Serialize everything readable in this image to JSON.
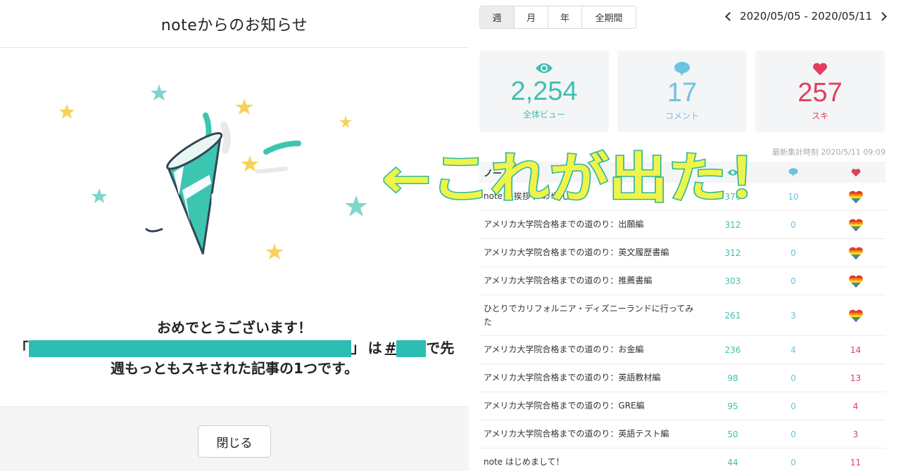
{
  "modal": {
    "title": "noteからのお知らせ",
    "message_line1": "おめでとうございます！",
    "open_quote": "「",
    "close_quote": "」",
    "mid_text": "は",
    "hash": "#",
    "after_rank": "で先",
    "message_line3": "週もっともスキされた記事の1つです。",
    "close_button": "閉じる",
    "colors": {
      "redaction": "#2bbcb3",
      "star_yellow": "#f7d25a",
      "star_teal": "#7fd6cc",
      "party": "#3cc5b0"
    }
  },
  "stats": {
    "tabs": [
      "週",
      "月",
      "年",
      "全期間"
    ],
    "active_tab": "週",
    "date_range": "2020/05/05 - 2020/05/11",
    "cards": {
      "views": {
        "value": "2,254",
        "label": "全体ビュー"
      },
      "comments": {
        "value": "17",
        "label": "コメント"
      },
      "likes": {
        "value": "257",
        "label": "スキ"
      }
    },
    "updated": "最新集計時刻 2020/5/11 09:09",
    "table_header": "ノート",
    "rows": [
      {
        "title": "noteで 挨拶す のや した！",
        "views": "376",
        "comments": "10",
        "likes": ""
      },
      {
        "title": "アメリカ大学院合格までの道のり：出願編",
        "views": "312",
        "comments": "0",
        "likes": ""
      },
      {
        "title": "アメリカ大学院合格までの道のり：英文履歴書編",
        "views": "312",
        "comments": "0",
        "likes": ""
      },
      {
        "title": "アメリカ大学院合格までの道のり：推薦書編",
        "views": "303",
        "comments": "0",
        "likes": ""
      },
      {
        "title": "ひとりでカリフォルニア・ディズニーランドに行ってみた",
        "views": "261",
        "comments": "3",
        "likes": ""
      },
      {
        "title": "アメリカ大学院合格までの道のり：お金編",
        "views": "236",
        "comments": "4",
        "likes": "14"
      },
      {
        "title": "アメリカ大学院合格までの道のり：英語教材編",
        "views": "98",
        "comments": "0",
        "likes": "13"
      },
      {
        "title": "アメリカ大学院合格までの道のり：GRE編",
        "views": "95",
        "comments": "0",
        "likes": "4"
      },
      {
        "title": "アメリカ大学院合格までの道のり：英語テスト編",
        "views": "50",
        "comments": "0",
        "likes": "3"
      },
      {
        "title": "note はじめまして！",
        "views": "44",
        "comments": "0",
        "likes": "11"
      }
    ],
    "colors": {
      "views": "#3fc0b0",
      "comments": "#6cc3e2",
      "likes": "#e0405e"
    }
  },
  "annotation": {
    "text": "←これが出た！",
    "colors": {
      "fill": "#eef54a",
      "outline": "#2fb59b"
    }
  }
}
